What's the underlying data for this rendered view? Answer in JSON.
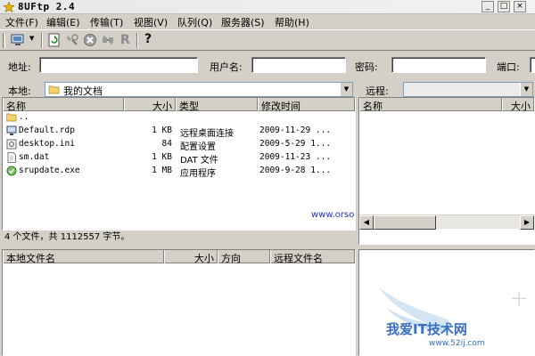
{
  "window": {
    "title": "8UFtp 2.4",
    "minimize": "_",
    "maximize": "□",
    "close": "×"
  },
  "menu": [
    "文件(F)",
    "编辑(E)",
    "传输(T)",
    "视图(V)",
    "队列(Q)",
    "服务器(S)",
    "帮助(H)"
  ],
  "toolbar_icons": [
    "site-manager-icon",
    "refresh-icon",
    "connect-icon",
    "stop-icon",
    "disconnect-icon",
    "reconnect-icon",
    "help-icon"
  ],
  "address_bar": {
    "address_label": "地址:",
    "address_value": "",
    "username_label": "用户名:",
    "username_value": "",
    "password_label": "密码:",
    "password_value": "",
    "port_label": "端口:",
    "port_value": ""
  },
  "local": {
    "location_label": "本地:",
    "location_value": "我的文档",
    "columns": [
      "名称",
      "大小",
      "类型",
      "修改时间"
    ],
    "files": [
      {
        "name": "..",
        "size": "",
        "type": "",
        "modified": ""
      },
      {
        "name": "Default.rdp",
        "size": "1 KB",
        "type": "远程桌面连接",
        "modified": "2009-11-29 ..."
      },
      {
        "name": "desktop.ini",
        "size": "84",
        "type": "配置设置",
        "modified": "2009-5-29 1..."
      },
      {
        "name": "sm.dat",
        "size": "1 KB",
        "type": "DAT 文件",
        "modified": "2009-11-23 ..."
      },
      {
        "name": "srupdate.exe",
        "size": "1 MB",
        "type": "应用程序",
        "modified": "2009-9-28 1..."
      }
    ],
    "status": "4 个文件，共 1112557 字节。"
  },
  "remote": {
    "location_label": "远程:",
    "location_value": "",
    "columns": [
      "名称",
      "大小"
    ]
  },
  "queue": {
    "columns": [
      "本地文件名",
      "大小",
      "方向",
      "远程文件名"
    ]
  },
  "watermarks": {
    "site": "www.orsoon.com",
    "brand": "我爱IT技术网",
    "brand_url": "www.52ij.com"
  },
  "colors": {
    "window_bg": "#d4d0c8",
    "watermark_blue": "#2233aa"
  }
}
